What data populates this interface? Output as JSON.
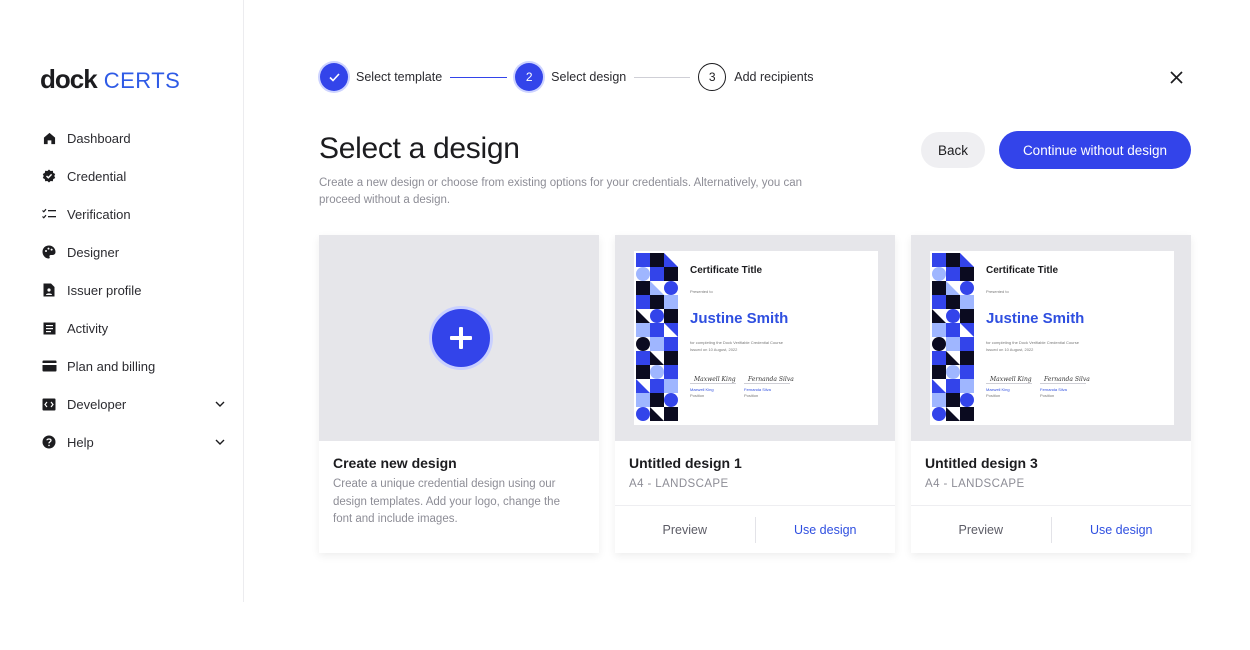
{
  "brand": {
    "logo_part1": "dock",
    "logo_part2": "CERTS",
    "accent": "#3344ea"
  },
  "sidebar": {
    "items": [
      {
        "label": "Dashboard",
        "icon": "home-icon"
      },
      {
        "label": "Credential",
        "icon": "badge-icon"
      },
      {
        "label": "Verification",
        "icon": "checklist-icon"
      },
      {
        "label": "Designer",
        "icon": "palette-icon"
      },
      {
        "label": "Issuer profile",
        "icon": "profile-doc-icon"
      },
      {
        "label": "Activity",
        "icon": "activity-icon"
      },
      {
        "label": "Plan and billing",
        "icon": "card-icon"
      },
      {
        "label": "Developer",
        "icon": "code-icon",
        "expandable": true
      },
      {
        "label": "Help",
        "icon": "help-icon",
        "expandable": true
      }
    ]
  },
  "stepper": {
    "steps": [
      {
        "number": "1",
        "label": "Select template",
        "state": "done"
      },
      {
        "number": "2",
        "label": "Select design",
        "state": "active"
      },
      {
        "number": "3",
        "label": "Add recipients",
        "state": "todo"
      }
    ]
  },
  "header": {
    "title": "Select a design",
    "description": "Create a new design or choose from existing options for your credentials. Alternatively, you can proceed without a design.",
    "back_label": "Back",
    "continue_label": "Continue without design"
  },
  "cards": {
    "create": {
      "title": "Create new design",
      "description": "Create a unique credential design using our design templates. Add your logo, change the font and include images."
    },
    "designs": [
      {
        "title": "Untitled design 1",
        "format": "A4 - LANDSCAPE",
        "preview_label": "Preview",
        "use_label": "Use design"
      },
      {
        "title": "Untitled design 3",
        "format": "A4 - LANDSCAPE",
        "preview_label": "Preview",
        "use_label": "Use design"
      }
    ],
    "certificate_preview": {
      "title": "Certificate Title",
      "presented_to": "Presented to",
      "recipient": "Justine Smith",
      "completion_text": "for completing the Dock Verifiable Credential Course",
      "issued_text": "Issued on 10 August, 2022",
      "signatures": [
        {
          "sign": "Maxwell King",
          "name": "Maxwell King",
          "role": "Position"
        },
        {
          "sign": "Fernanda Silva",
          "name": "Fernanda Silva",
          "role": "Position"
        }
      ]
    }
  }
}
